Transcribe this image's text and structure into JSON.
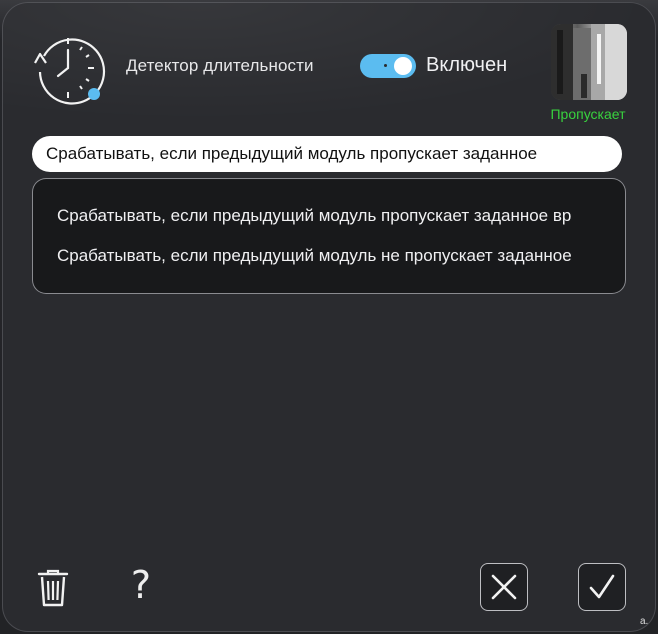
{
  "dialog": {
    "title": "Детектор длительности",
    "icon": "clock-icon",
    "toggle": {
      "state": "on",
      "label": "Включен",
      "color": "#5bbcf0"
    },
    "preview": {
      "status": "Пропускает",
      "status_color": "#38d23e"
    }
  },
  "select": {
    "value": "Срабатывать, если предыдущий модуль пропускает заданное",
    "options": [
      "Срабатывать, если предыдущий модуль пропускает заданное вр",
      "Срабатывать, если предыдущий модуль не пропускает заданное"
    ]
  },
  "footer": {
    "delete_icon": "trash-icon",
    "help_label": "?",
    "cancel_icon": "close-icon",
    "confirm_icon": "check-icon"
  },
  "corner_text": "a."
}
